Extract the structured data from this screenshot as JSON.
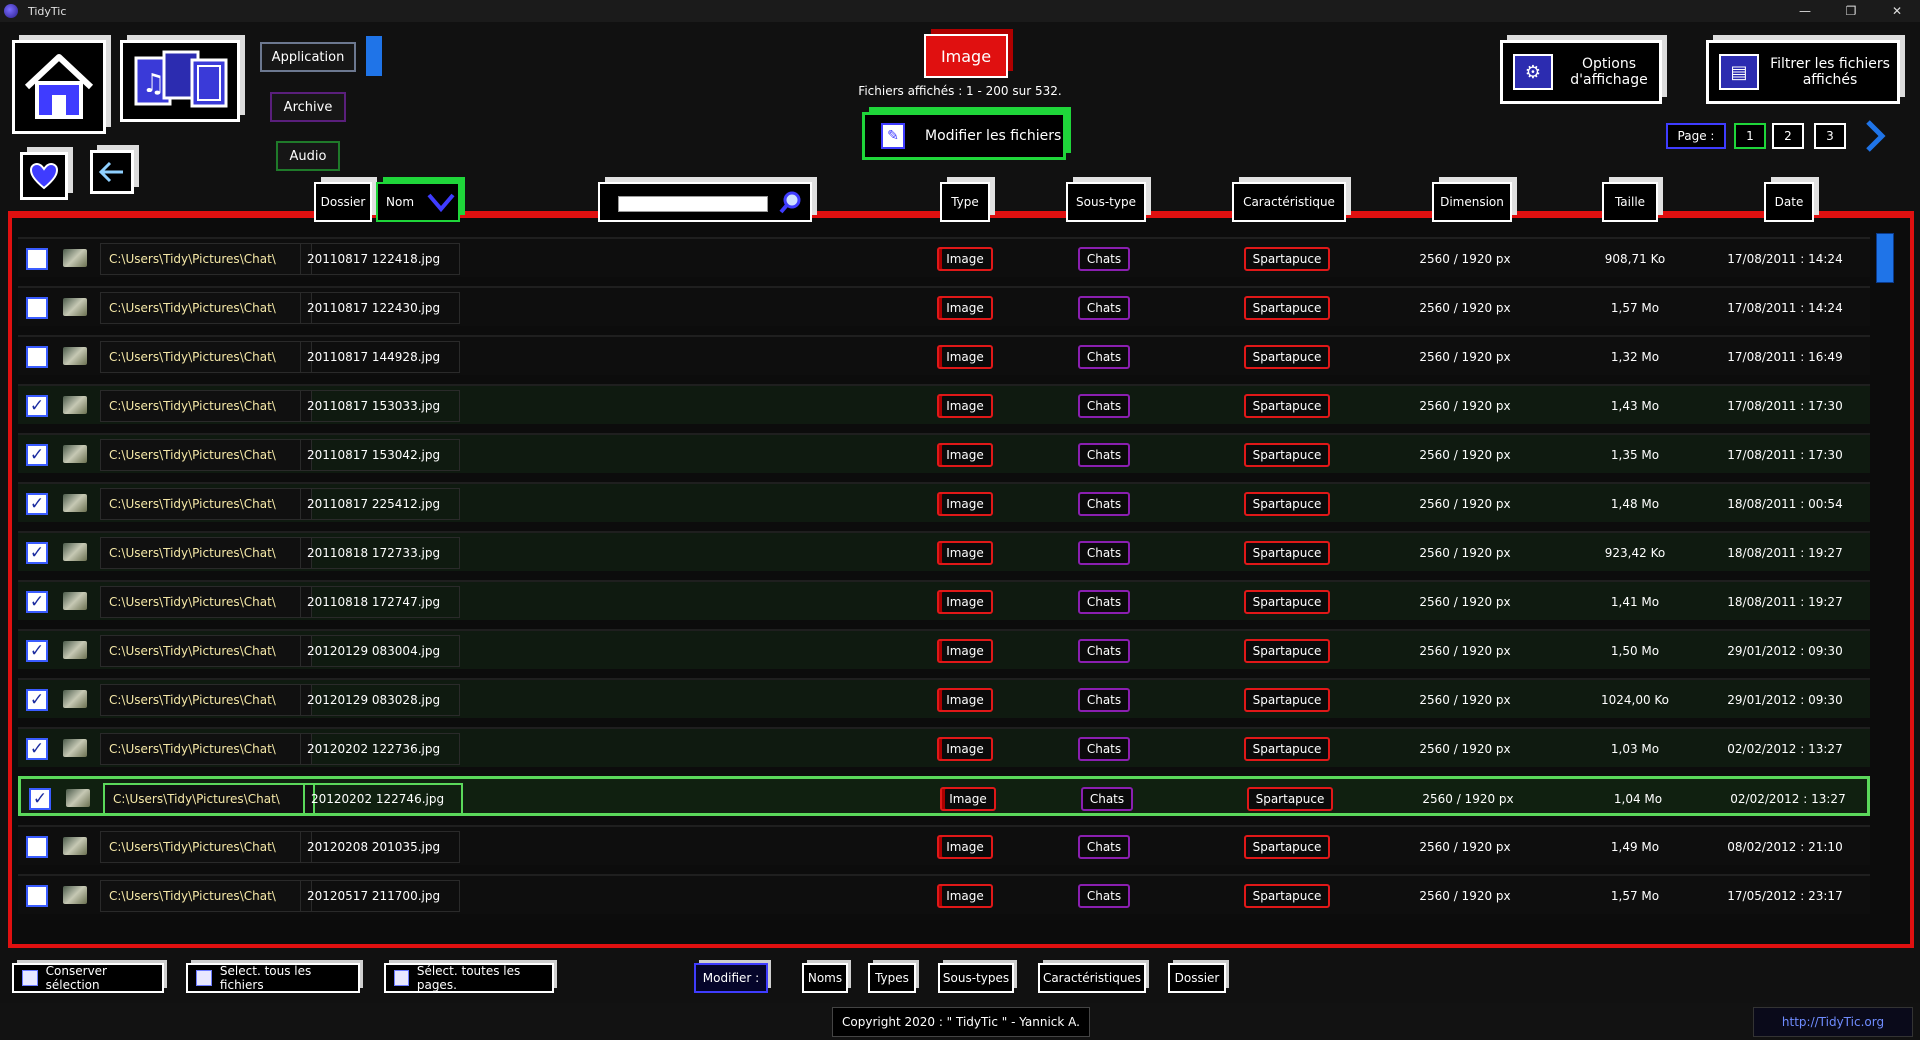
{
  "window": {
    "title": "TidyTic",
    "controls": [
      "—",
      "❐",
      "✕"
    ]
  },
  "nav": {
    "application": "Application",
    "archive": "Archive",
    "audio": "Audio"
  },
  "current_type": "Image",
  "files_displayed": "Fichiers affichés : 1 - 200 sur 532.",
  "modify_files": "Modifier les fichiers",
  "options_display": "Options d'affichage",
  "filter_files": "Filtrer les fichiers affichés",
  "pagination": {
    "label": "Page :",
    "pages": [
      "1",
      "2",
      "3"
    ]
  },
  "columns": {
    "dossier": "Dossier",
    "nom": "Nom",
    "type": "Type",
    "soustype": "Sous-type",
    "caracteristique": "Caractéristique",
    "dimension": "Dimension",
    "taille": "Taille",
    "date": "Date"
  },
  "search": {
    "value": ""
  },
  "rows": [
    {
      "checked": false,
      "path": "C:\\Users\\Tidy\\Pictures\\Chat\\",
      "name": "20110817 122418.jpg",
      "type": "Image",
      "subtype": "Chats",
      "charac": "Spartapuce",
      "dim": "2560 / 1920 px",
      "size": "908,71 Ko",
      "date": "17/08/2011 : 14:24"
    },
    {
      "checked": false,
      "path": "C:\\Users\\Tidy\\Pictures\\Chat\\",
      "name": "20110817 122430.jpg",
      "type": "Image",
      "subtype": "Chats",
      "charac": "Spartapuce",
      "dim": "2560 / 1920 px",
      "size": "1,57 Mo",
      "date": "17/08/2011 : 14:24"
    },
    {
      "checked": false,
      "path": "C:\\Users\\Tidy\\Pictures\\Chat\\",
      "name": "20110817 144928.jpg",
      "type": "Image",
      "subtype": "Chats",
      "charac": "Spartapuce",
      "dim": "2560 / 1920 px",
      "size": "1,32 Mo",
      "date": "17/08/2011 : 16:49"
    },
    {
      "checked": true,
      "path": "C:\\Users\\Tidy\\Pictures\\Chat\\",
      "name": "20110817 153033.jpg",
      "type": "Image",
      "subtype": "Chats",
      "charac": "Spartapuce",
      "dim": "2560 / 1920 px",
      "size": "1,43 Mo",
      "date": "17/08/2011 : 17:30"
    },
    {
      "checked": true,
      "path": "C:\\Users\\Tidy\\Pictures\\Chat\\",
      "name": "20110817 153042.jpg",
      "type": "Image",
      "subtype": "Chats",
      "charac": "Spartapuce",
      "dim": "2560 / 1920 px",
      "size": "1,35 Mo",
      "date": "17/08/2011 : 17:30"
    },
    {
      "checked": true,
      "path": "C:\\Users\\Tidy\\Pictures\\Chat\\",
      "name": "20110817 225412.jpg",
      "type": "Image",
      "subtype": "Chats",
      "charac": "Spartapuce",
      "dim": "2560 / 1920 px",
      "size": "1,48 Mo",
      "date": "18/08/2011 : 00:54"
    },
    {
      "checked": true,
      "path": "C:\\Users\\Tidy\\Pictures\\Chat\\",
      "name": "20110818 172733.jpg",
      "type": "Image",
      "subtype": "Chats",
      "charac": "Spartapuce",
      "dim": "2560 / 1920 px",
      "size": "923,42 Ko",
      "date": "18/08/2011 : 19:27"
    },
    {
      "checked": true,
      "path": "C:\\Users\\Tidy\\Pictures\\Chat\\",
      "name": "20110818 172747.jpg",
      "type": "Image",
      "subtype": "Chats",
      "charac": "Spartapuce",
      "dim": "2560 / 1920 px",
      "size": "1,41 Mo",
      "date": "18/08/2011 : 19:27"
    },
    {
      "checked": true,
      "path": "C:\\Users\\Tidy\\Pictures\\Chat\\",
      "name": "20120129 083004.jpg",
      "type": "Image",
      "subtype": "Chats",
      "charac": "Spartapuce",
      "dim": "2560 / 1920 px",
      "size": "1,50 Mo",
      "date": "29/01/2012 : 09:30"
    },
    {
      "checked": true,
      "path": "C:\\Users\\Tidy\\Pictures\\Chat\\",
      "name": "20120129 083028.jpg",
      "type": "Image",
      "subtype": "Chats",
      "charac": "Spartapuce",
      "dim": "2560 / 1920 px",
      "size": "1024,00 Ko",
      "date": "29/01/2012 : 09:30"
    },
    {
      "checked": true,
      "path": "C:\\Users\\Tidy\\Pictures\\Chat\\",
      "name": "20120202 122736.jpg",
      "type": "Image",
      "subtype": "Chats",
      "charac": "Spartapuce",
      "dim": "2560 / 1920 px",
      "size": "1,03 Mo",
      "date": "02/02/2012 : 13:27"
    },
    {
      "checked": true,
      "selected": true,
      "path": "C:\\Users\\Tidy\\Pictures\\Chat\\",
      "name": "20120202 122746.jpg",
      "type": "Image",
      "subtype": "Chats",
      "charac": "Spartapuce",
      "dim": "2560 / 1920 px",
      "size": "1,04 Mo",
      "date": "02/02/2012 : 13:27"
    },
    {
      "checked": false,
      "path": "C:\\Users\\Tidy\\Pictures\\Chat\\",
      "name": "20120208 201035.jpg",
      "type": "Image",
      "subtype": "Chats",
      "charac": "Spartapuce",
      "dim": "2560 / 1920 px",
      "size": "1,49 Mo",
      "date": "08/02/2012 : 21:10"
    },
    {
      "checked": false,
      "path": "C:\\Users\\Tidy\\Pictures\\Chat\\",
      "name": "20120517 211700.jpg",
      "type": "Image",
      "subtype": "Chats",
      "charac": "Spartapuce",
      "dim": "2560 / 1920 px",
      "size": "1,57 Mo",
      "date": "17/05/2012 : 23:17"
    }
  ],
  "bottom": {
    "keep_selection": "Conserver sélection",
    "select_all_files": "Select. tous les fichiers",
    "select_all_pages": "Sélect. toutes les pages.",
    "modify": "Modifier :",
    "names": "Noms",
    "types": "Types",
    "subtypes": "Sous-types",
    "characteristics": "Caractéristiques",
    "folder": "Dossier"
  },
  "footer": {
    "copyright": "Copyright 2020 : \" TidyTic \" - Yannick A.",
    "link": "http://TidyTic.org"
  },
  "colors": {
    "accent_red": "#e01010",
    "accent_green": "#1fd63a",
    "accent_blue": "#1f74e8",
    "accent_purple": "#8a1fb0"
  }
}
